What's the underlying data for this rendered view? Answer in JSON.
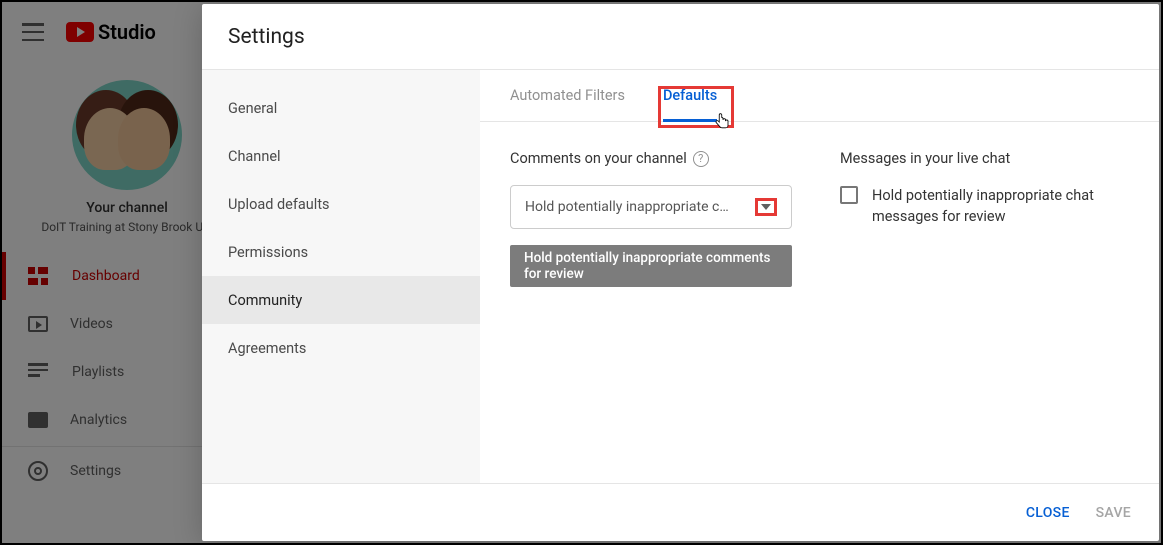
{
  "brand": {
    "name": "Studio"
  },
  "channel": {
    "title": "Your channel",
    "subtitle": "DoIT Training at Stony Brook Uni"
  },
  "bgNav": {
    "dashboard": "Dashboard",
    "videos": "Videos",
    "playlists": "Playlists",
    "analytics": "Analytics",
    "settings": "Settings"
  },
  "modal": {
    "title": "Settings",
    "nav": {
      "general": "General",
      "channel": "Channel",
      "upload_defaults": "Upload defaults",
      "permissions": "Permissions",
      "community": "Community",
      "agreements": "Agreements"
    },
    "tabs": {
      "automated_filters": "Automated Filters",
      "defaults": "Defaults"
    },
    "comments": {
      "heading": "Comments on your channel",
      "select_value": "Hold potentially inappropriate c…",
      "dropdown_option": "Hold potentially inappropriate comments for review"
    },
    "livechat": {
      "heading": "Messages in your live chat",
      "checkbox_label": "Hold potentially inappropriate chat messages for review"
    },
    "footer": {
      "close": "Close",
      "save": "Save"
    }
  }
}
